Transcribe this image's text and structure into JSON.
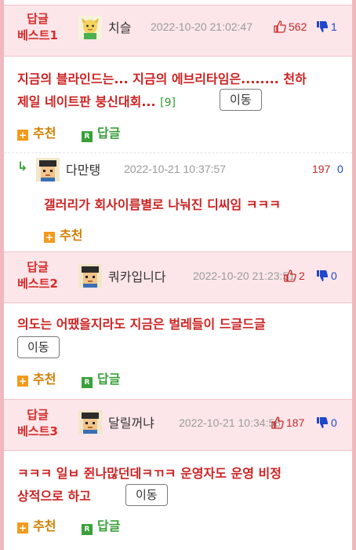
{
  "colors": {
    "accent_red": "#d62b2b",
    "header_bg": "#fde6e9",
    "border_pink": "#f2b8bf",
    "like_red": "#c62828",
    "dislike_blue": "#1e47c9",
    "action_orange": "#d27e00",
    "reply_green": "#3aa13a"
  },
  "comments": [
    {
      "best_label": [
        "답글",
        "베스트1"
      ],
      "avatar": "character-avatar-icon",
      "nick": "치슬",
      "date": "2022-10-20 21:02:47",
      "likes": "562",
      "dislikes": "1",
      "text_line1": "지금의 블라인드는... 지금의 에브리타임은........ 천하",
      "text_line2": "제일 네이트판 붕신대회...",
      "reply_count": "[9]",
      "move_label": "이동",
      "recommend_label": "추천",
      "reply_label": "답글"
    },
    {
      "best_label": [
        "답글",
        "베스트2"
      ],
      "avatar": "pixel-face-avatar-icon",
      "nick": "쿼카입니다",
      "date": "2022-10-20 21:23:51",
      "likes": "2",
      "dislikes": "0",
      "text_line1": "의도는 어땠을지라도 지금은 벌레들이 드글드글",
      "move_label": "이동",
      "recommend_label": "추천",
      "reply_label": "답글"
    },
    {
      "best_label": [
        "답글",
        "베스트3"
      ],
      "avatar": "pixel-face-avatar-icon",
      "nick": "달릴꺼냐",
      "date": "2022-10-21 10:34:58",
      "likes": "187",
      "dislikes": "0",
      "text_line1": "ㅋㅋㅋ 일ㅂ 쥔나많던데ㅋㄲㅋ 운영자도 운영 비정",
      "text_line2": "상적으로 하고",
      "move_label": "이동",
      "recommend_label": "추천",
      "reply_label": "답글"
    }
  ],
  "sub_reply": {
    "avatar": "pixel-face-avatar-icon",
    "nick": "다만탱",
    "date": "2022-10-21 10:37:57",
    "likes": "197",
    "dislikes": "0",
    "text": "갤러리가 회사이름별로 나눠진 디씨임 ㅋㅋㅋ",
    "recommend_label": "추천"
  }
}
